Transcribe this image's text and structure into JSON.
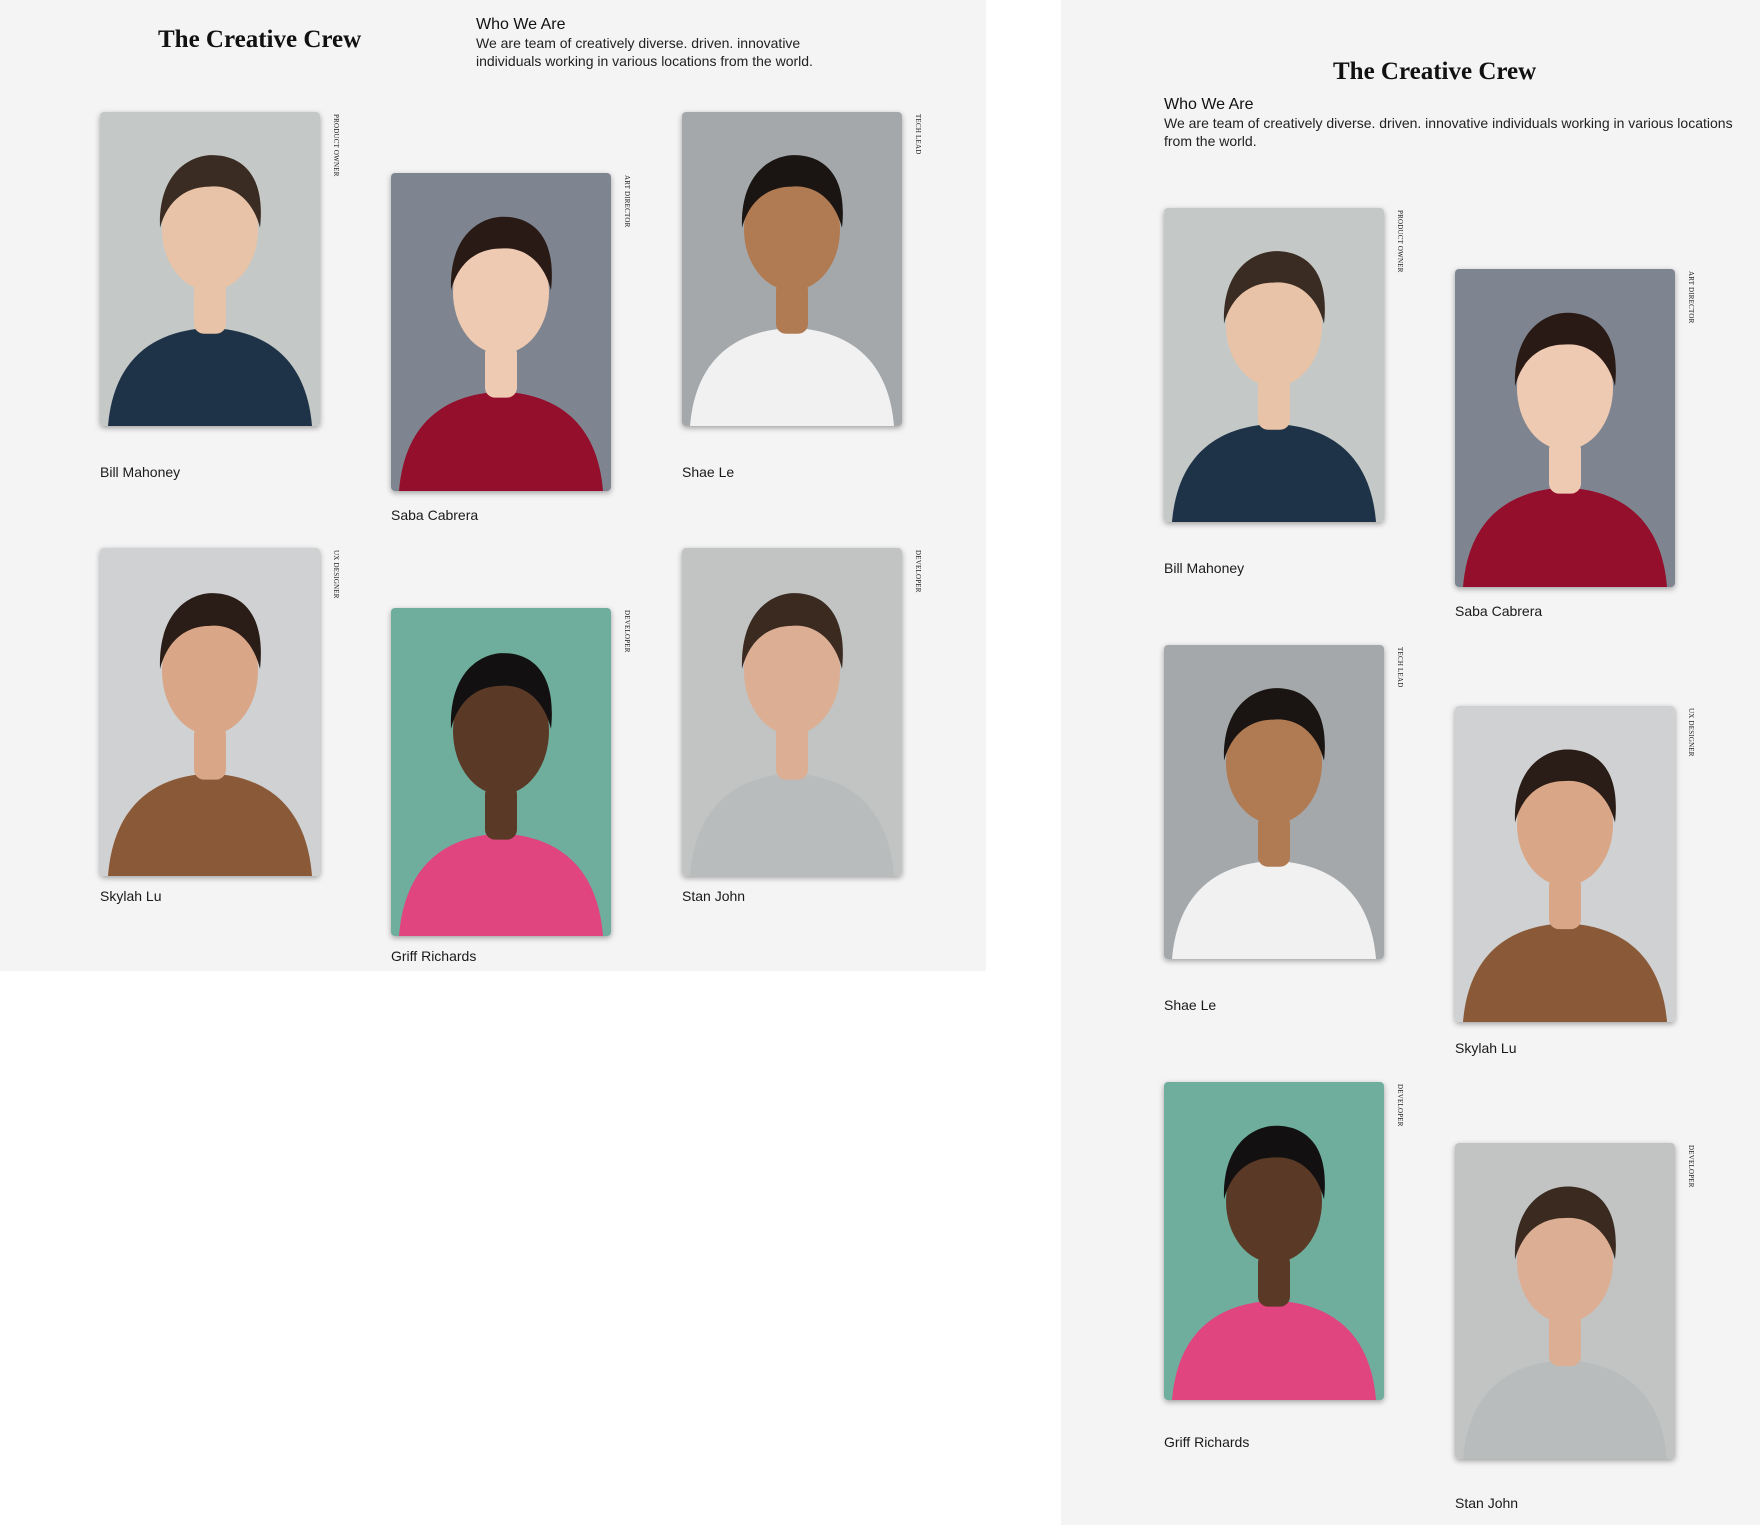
{
  "page": {
    "title": "The Creative Crew",
    "who_heading": "Who We Are",
    "who_text": "We are team of creatively diverse. driven. innovative individuals working in various locations from the world."
  },
  "members": [
    {
      "name": "Bill Mahoney",
      "role": "PRODUCT OWNER",
      "photo": "portrait-man-navy-polo",
      "bg": "#c4c8c6",
      "shirt": "#1e3347",
      "skin": "#e8c3a8",
      "hair": "#3a2c22"
    },
    {
      "name": "Saba Cabrera",
      "role": "ART DIRECTOR",
      "photo": "portrait-woman-red-top",
      "bg": "#7f8590",
      "shirt": "#930f2c",
      "skin": "#efcab2",
      "hair": "#2a1a16"
    },
    {
      "name": "Shae Le",
      "role": "TECH LEAD",
      "photo": "portrait-man-white-tee",
      "bg": "#a5a8aa",
      "shirt": "#f1f1f1",
      "skin": "#b07a52",
      "hair": "#1a1512"
    },
    {
      "name": "Skylah Lu",
      "role": "UX DESIGNER",
      "photo": "portrait-woman-leopard-top",
      "bg": "#cfd1d2",
      "shirt": "#8a5a38",
      "skin": "#d9a787",
      "hair": "#2a1c16"
    },
    {
      "name": "Griff Richards",
      "role": "DEVELOPER",
      "photo": "portrait-man-striped-tee",
      "bg": "#6fae9c",
      "shirt": "#e0457f",
      "skin": "#5a3a26",
      "hair": "#121010"
    },
    {
      "name": "Stan John",
      "role": "DEVELOPER",
      "photo": "portrait-man-grey-sweater",
      "bg": "#c2c4c4",
      "shirt": "#b9bcbd",
      "skin": "#dcae94",
      "hair": "#3a2a20"
    }
  ]
}
